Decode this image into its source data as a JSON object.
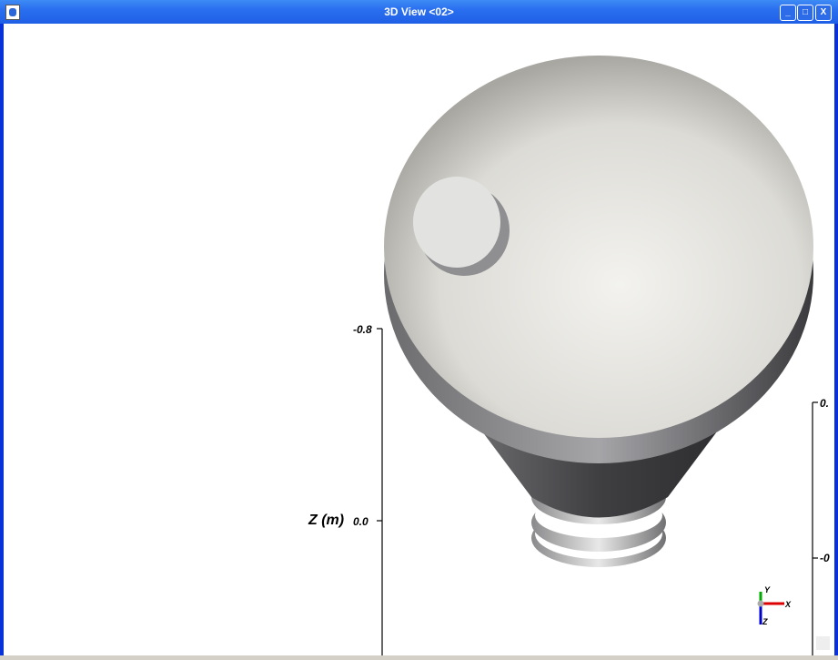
{
  "window": {
    "title": "3D View <02>",
    "minimize": "_",
    "maximize": "□",
    "close": "X"
  },
  "axis_left": {
    "label": "Z (m)",
    "ticks": [
      "-0.8",
      "0.0"
    ]
  },
  "axis_right": {
    "ticks": [
      "0.",
      "-0"
    ]
  },
  "triad": {
    "x": "X",
    "y": "Y",
    "z": "Z"
  }
}
